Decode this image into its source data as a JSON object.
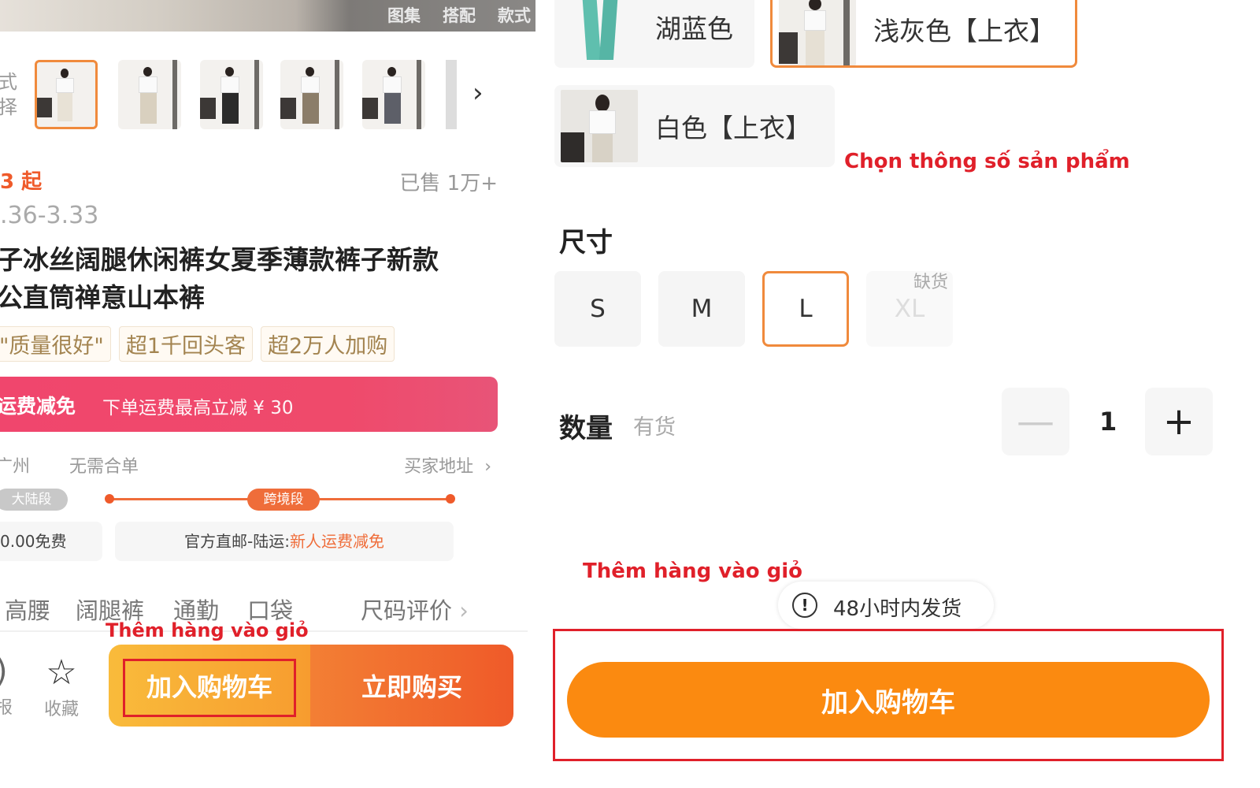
{
  "left": {
    "gallery_tabs": [
      "图集",
      "搭配",
      "款式"
    ],
    "variant_label": "式\n择",
    "price_start": "3 起",
    "sold": "已售 1万+",
    "price_range": ".36-3.33",
    "title_line1": "子冰丝阔腿休闲裤女夏季薄款裤子新款",
    "title_line2": "公直筒禅意山本裤",
    "tags": [
      "\"质量很好\"",
      "超1千回头客",
      "超2万人加购"
    ],
    "promo_tag": "运费减免",
    "promo_text": "下单运费最高立减 ¥ 30",
    "ship_from": "广州",
    "ship_merge": "无需合单",
    "ship_addr": "买家地址",
    "route_seg1": "大陆段",
    "route_seg2": "跨境段",
    "ship_fee": "0.00免费",
    "ship_method": "官方直邮-陆运:",
    "ship_method_promo": "新人运费减免",
    "attrs": [
      "高腰",
      "阔腿裤",
      "通勤",
      "口袋"
    ],
    "size_review": "尺码评价",
    "annotation": "Thêm hàng vào giỏ",
    "left_partial": "报",
    "favorite_label": "收藏",
    "add_to_cart": "加入购物车",
    "buy_now": "立即购买"
  },
  "right": {
    "colors": [
      {
        "label": "湖蓝色"
      },
      {
        "label": "浅灰色【上衣】"
      },
      {
        "label": "白色【上衣】"
      }
    ],
    "annotation_specs": "Chọn thông số sản phẩm",
    "size_title": "尺寸",
    "sizes": [
      "S",
      "M",
      "L",
      "XL"
    ],
    "out_of_stock": "缺货",
    "qty_title": "数量",
    "qty_stock": "有货",
    "qty_value": "1",
    "qty_minus": "—",
    "qty_plus": "+",
    "annotation_cart": "Thêm hàng vào giỏ",
    "info_icon": "!",
    "ship_notice": "48小时内发货",
    "add_to_cart": "加入购物车"
  },
  "colors": {
    "accent_orange": "#f08a3c",
    "cart_orange": "#fb8a10",
    "promo_pink": "#f0466d",
    "annotation_red": "#e0202a"
  }
}
